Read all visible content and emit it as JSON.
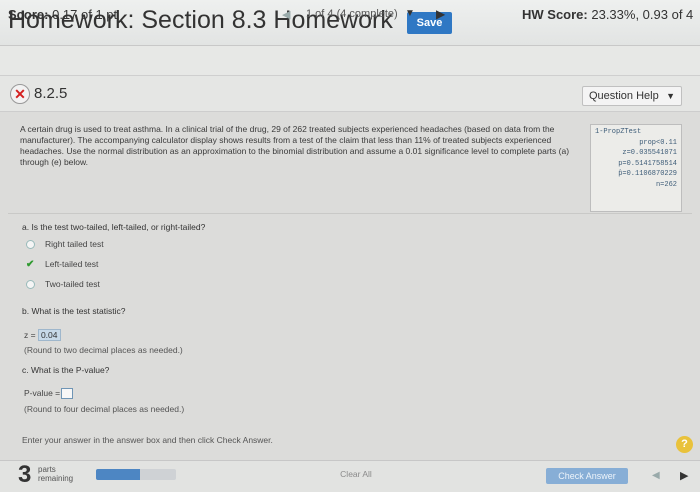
{
  "header": {
    "title": "Homework: Section 8.3 Homework",
    "save_label": "Save"
  },
  "scorebar": {
    "score_label": "Score:",
    "score_value": "0.17 of 1 pt",
    "nav_prev_icon": "triangle-left",
    "nav_count": "1 of 4 (4 complete)",
    "nav_dropdown_icon": "caret-down",
    "nav_next_icon": "triangle-right",
    "hw_score_label": "HW Score:",
    "hw_score_value": "23.33%, 0.93 of 4"
  },
  "question": {
    "number": "8.2.5",
    "status_icon": "incorrect-x",
    "help_label": "Question Help",
    "stem": "A certain drug is used to treat asthma. In a clinical trial of the drug, 29 of 262 treated subjects experienced headaches (based on data from the manufacturer). The accompanying calculator display shows results from a test of the claim that less than 11% of treated subjects experienced headaches. Use the normal distribution as an approximation to the binomial distribution and assume a 0.01 significance level to complete parts (a) through (e) below.",
    "calculator": {
      "l1": "1-PropZTest",
      "l2": "prop<0.11",
      "l3": "z=0.035541071",
      "l4": "p=0.5141758514",
      "l5": "p̂=0.1106870229",
      "l6": "n=262"
    }
  },
  "part_a": {
    "prompt": "a. Is the test two-tailed, left-tailed, or right-tailed?",
    "options": [
      "Right tailed test",
      "Left-tailed test",
      "Two-tailed test"
    ],
    "selected_index": 1
  },
  "part_b": {
    "prompt": "b. What is the test statistic?",
    "z_prefix": "z =",
    "z_value": "0.04",
    "round_note": "(Round to two decimal places as needed.)"
  },
  "part_c": {
    "prompt": "c. What is the P-value?",
    "p_prefix": "P-value =",
    "p_value": "",
    "round_note": "(Round to four decimal places as needed.)"
  },
  "instructions": "Enter your answer in the answer box and then click Check Answer.",
  "help_icon": "question-mark",
  "footer": {
    "parts_count": "3",
    "parts_label_1": "parts",
    "parts_label_2": "remaining",
    "progress_fraction": 0.55,
    "clear_label": "Clear All",
    "check_label": "Check Answer",
    "prev_icon": "triangle-left",
    "next_icon": "triangle-right"
  },
  "colors": {
    "save_button": "#2f78c4",
    "progress_fill": "#4d86c3",
    "check_button": "#87aed6",
    "incorrect": "#d42020",
    "correct_check": "#2f9a2f",
    "help_badge": "#e9c23b"
  }
}
